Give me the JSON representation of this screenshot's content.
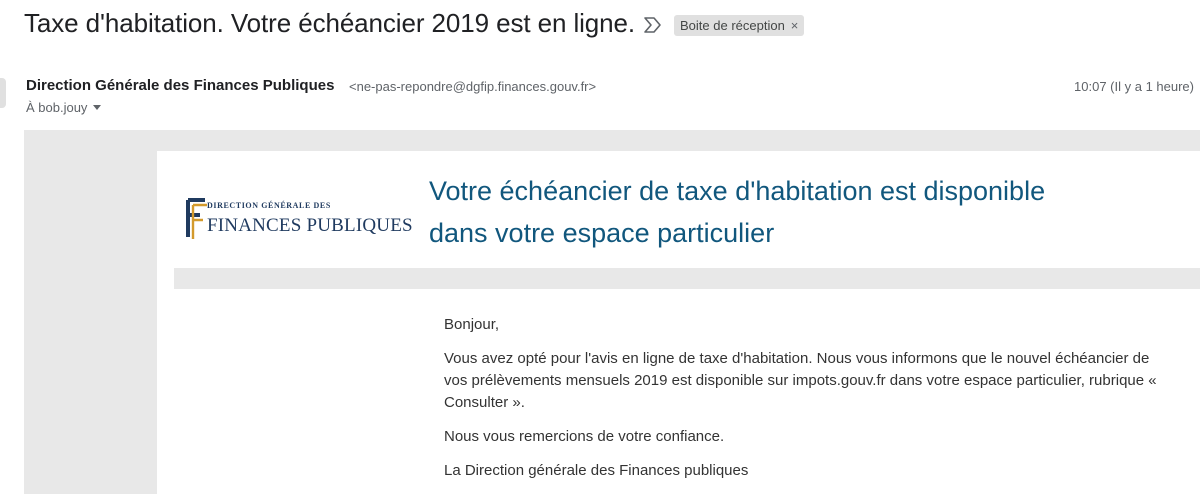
{
  "subject": {
    "title": "Taxe d'habitation. Votre échéancier 2019 est en ligne.",
    "importance_icon": "importance-marker-icon",
    "label": "Boite de réception",
    "label_close": "×"
  },
  "sender": {
    "name": "Direction Générale des Finances Publiques",
    "email": "<ne-pas-repondre@dgfip.finances.gouv.fr>",
    "time": "10:07 (Il y a 1 heure)",
    "recipient": "À bob.jouy"
  },
  "message": {
    "logo": {
      "top_line": "DIRECTION GÉNÉRALE DES",
      "main_line": "FINANCES PUBLIQUES",
      "brand_colors": {
        "navy": "#1f3a5f",
        "gold": "#d39a2c"
      }
    },
    "headline_line1": "Votre échéancier de taxe d'habitation est disponible",
    "headline_line2": "dans votre espace particulier",
    "greeting": "Bonjour,",
    "paragraph1": "Vous avez opté pour l'avis en ligne de taxe d'habitation. Nous vous informons que le nouvel échéancier de vos prélèvements mensuels 2019 est disponible sur impots.gouv.fr dans votre espace particulier, rubrique « Consulter ».",
    "paragraph2": "Nous vous remercions de votre confiance.",
    "signature": "La Direction générale des Finances publiques"
  },
  "colors": {
    "headline": "#11577d",
    "canvas_bg": "#e8e8e8"
  }
}
